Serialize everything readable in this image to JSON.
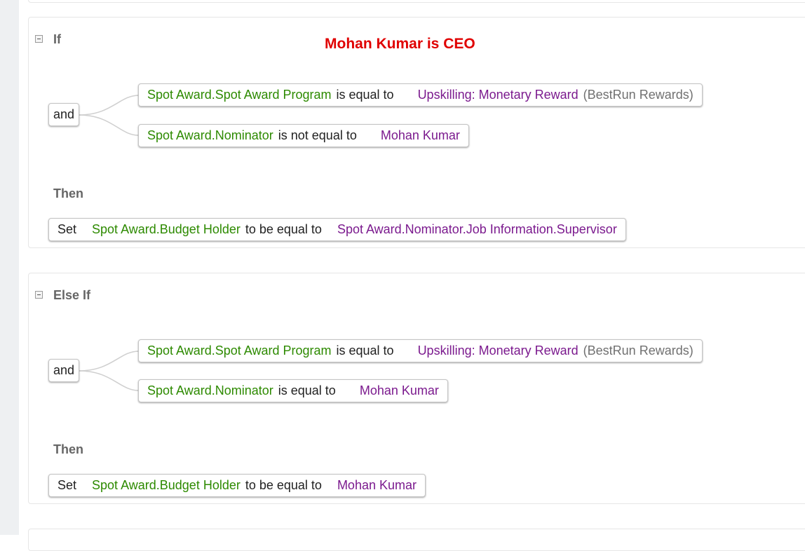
{
  "annotation": "Mohan Kumar is CEO",
  "if_block": {
    "label": "If",
    "operator": "and",
    "conditions": [
      {
        "field": "Spot Award.Spot Award Program",
        "op": "is equal to",
        "value": "Upskilling: Monetary Reward",
        "value_suffix": "(BestRun Rewards)"
      },
      {
        "field": "Spot Award.Nominator",
        "op": "is not equal to",
        "value": "Mohan Kumar"
      }
    ],
    "then_label": "Then",
    "action": {
      "verb": "Set",
      "field": "Spot Award.Budget Holder",
      "op": "to be equal to",
      "value": "Spot Award.Nominator.Job Information.Supervisor"
    }
  },
  "else_if_block": {
    "label": "Else If",
    "operator": "and",
    "conditions": [
      {
        "field": "Spot Award.Spot Award Program",
        "op": "is equal to",
        "value": "Upskilling: Monetary Reward",
        "value_suffix": "(BestRun Rewards)"
      },
      {
        "field": "Spot Award.Nominator",
        "op": "is equal to",
        "value": "Mohan Kumar"
      }
    ],
    "then_label": "Then",
    "action": {
      "verb": "Set",
      "field": "Spot Award.Budget Holder",
      "op": "to be equal to",
      "value": "Mohan Kumar"
    }
  },
  "colors": {
    "field": "#2d8a00",
    "value": "#7b1a8e",
    "annotation": "#e00000",
    "label": "#666666"
  }
}
